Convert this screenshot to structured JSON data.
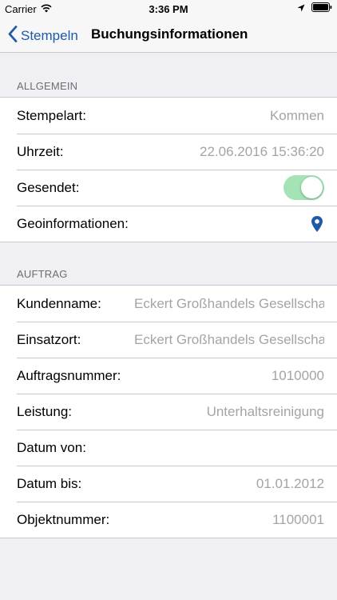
{
  "status_bar": {
    "carrier": "Carrier",
    "time": "3:36 PM"
  },
  "nav": {
    "back_label": "Stempeln",
    "title": "Buchungsinformationen"
  },
  "sections": {
    "allgemein": {
      "header": "ALLGEMEIN",
      "rows": [
        {
          "label": "Stempelart:",
          "value": "Kommen"
        },
        {
          "label": "Uhrzeit:",
          "value": "22.06.2016 15:36:20"
        },
        {
          "label": "Gesendet:",
          "toggle_on": true
        },
        {
          "label": "Geoinformationen:",
          "icon": "location-pin-icon"
        }
      ]
    },
    "auftrag": {
      "header": "AUFTRAG",
      "rows": [
        {
          "label": "Kundenname:",
          "value": "Eckert Großhandels Gesellschaf"
        },
        {
          "label": "Einsatzort:",
          "value": "Eckert Großhandels Gesellschaf"
        },
        {
          "label": "Auftragsnummer:",
          "value": "1010000"
        },
        {
          "label": "Leistung:",
          "value": "Unterhaltsreinigung"
        },
        {
          "label": "Datum von:",
          "value": ""
        },
        {
          "label": "Datum bis:",
          "value": "01.01.2012"
        },
        {
          "label": "Objektnummer:",
          "value": "1100001"
        }
      ]
    }
  },
  "colors": {
    "accent": "#1e5aa8",
    "toggle_on": "#a3e3b5",
    "value_text": "#a4a4a8",
    "background": "#efeff4"
  }
}
